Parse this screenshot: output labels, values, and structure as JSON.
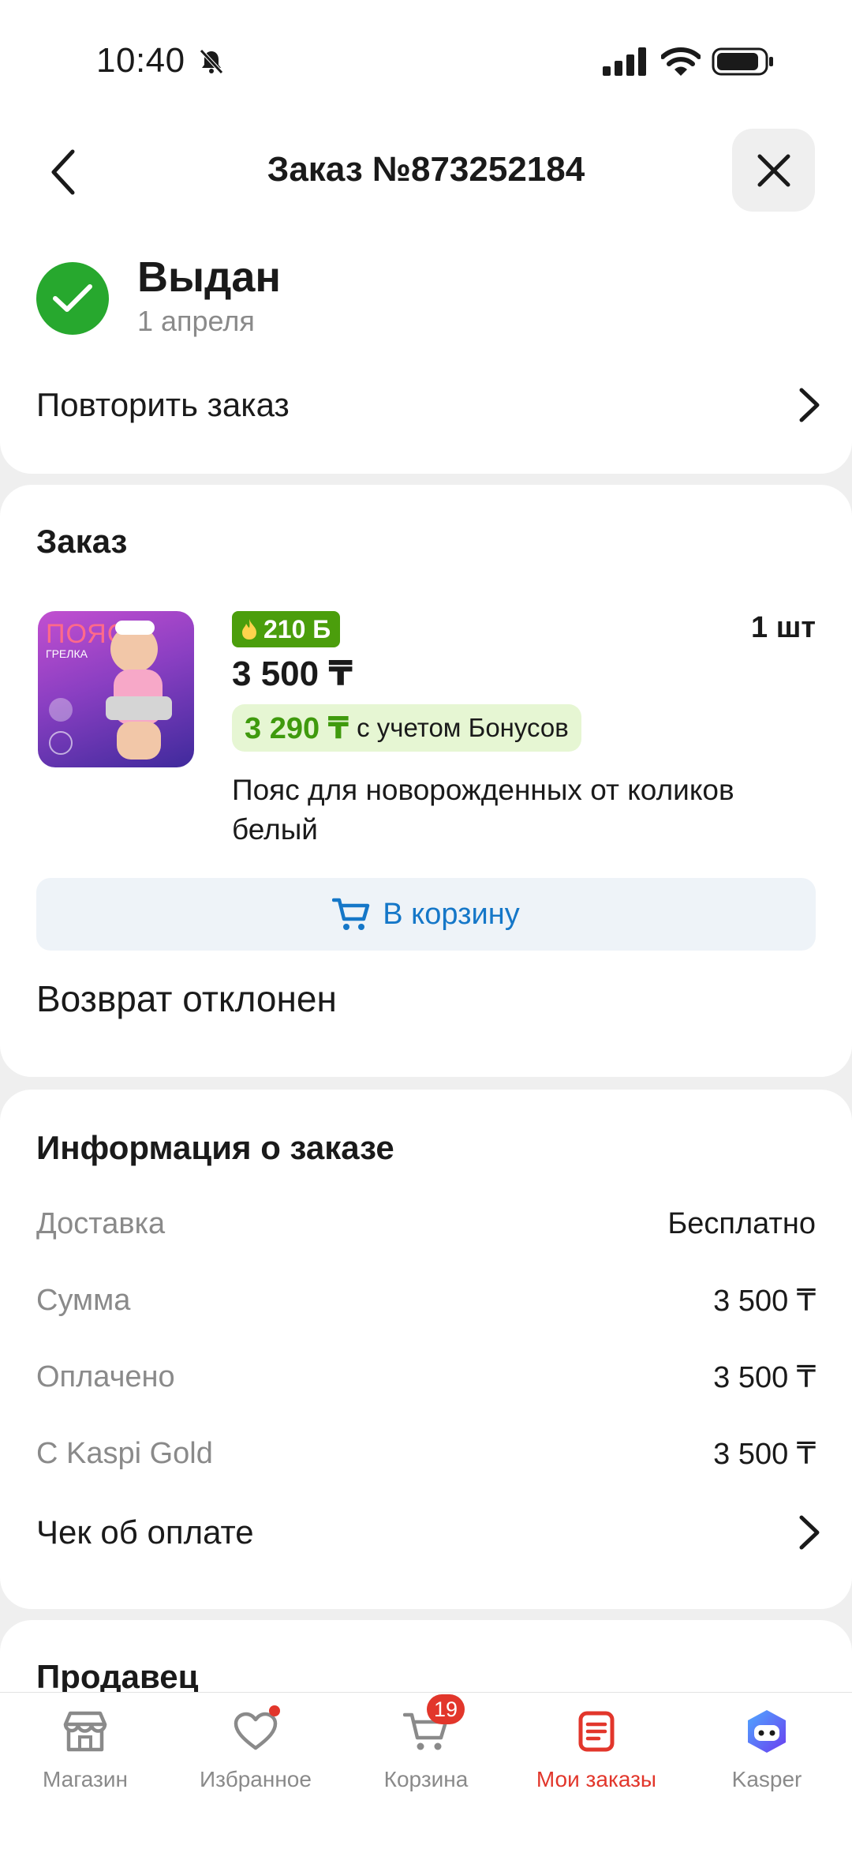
{
  "status_bar": {
    "time": "10:40"
  },
  "header": {
    "title": "Заказ №873252184"
  },
  "order_status": {
    "title": "Выдан",
    "date": "1 апреля",
    "repeat_label": "Повторить заказ"
  },
  "order": {
    "section_title": "Заказ",
    "product": {
      "image_text": "ПОЯС",
      "image_subtext": "ГРЕЛКА",
      "bonus_badge": "210 Б",
      "quantity": "1 шт",
      "price": "3 500 ₸",
      "bonus_price": "3 290 ₸",
      "bonus_note": "с учетом Бонусов",
      "name": "Пояс для новорожденных от коликов белый"
    },
    "cart_button_label": "В корзину",
    "return_status": "Возврат отклонен"
  },
  "info": {
    "section_title": "Информация о заказе",
    "rows": [
      {
        "key": "Доставка",
        "value": "Бесплатно"
      },
      {
        "key": "Сумма",
        "value": "3 500 ₸"
      },
      {
        "key": "Оплачено",
        "value": "3 500 ₸"
      },
      {
        "key": "С Kaspi Gold",
        "value": "3 500 ₸"
      }
    ],
    "receipt_label": "Чек об оплате"
  },
  "seller": {
    "section_title": "Продавец"
  },
  "bottom_nav": {
    "items": [
      {
        "label": "Магазин",
        "icon": "store-icon"
      },
      {
        "label": "Избранное",
        "icon": "heart-icon"
      },
      {
        "label": "Корзина",
        "icon": "cart-icon",
        "badge": "19"
      },
      {
        "label": "Мои заказы",
        "icon": "orders-icon",
        "active": true
      },
      {
        "label": "Kasper",
        "icon": "kasper-icon"
      }
    ]
  },
  "colors": {
    "accent_green": "#27a82e",
    "bonus_green": "#4b9e0c",
    "link_blue": "#1577c8",
    "active_red": "#e2362b"
  }
}
